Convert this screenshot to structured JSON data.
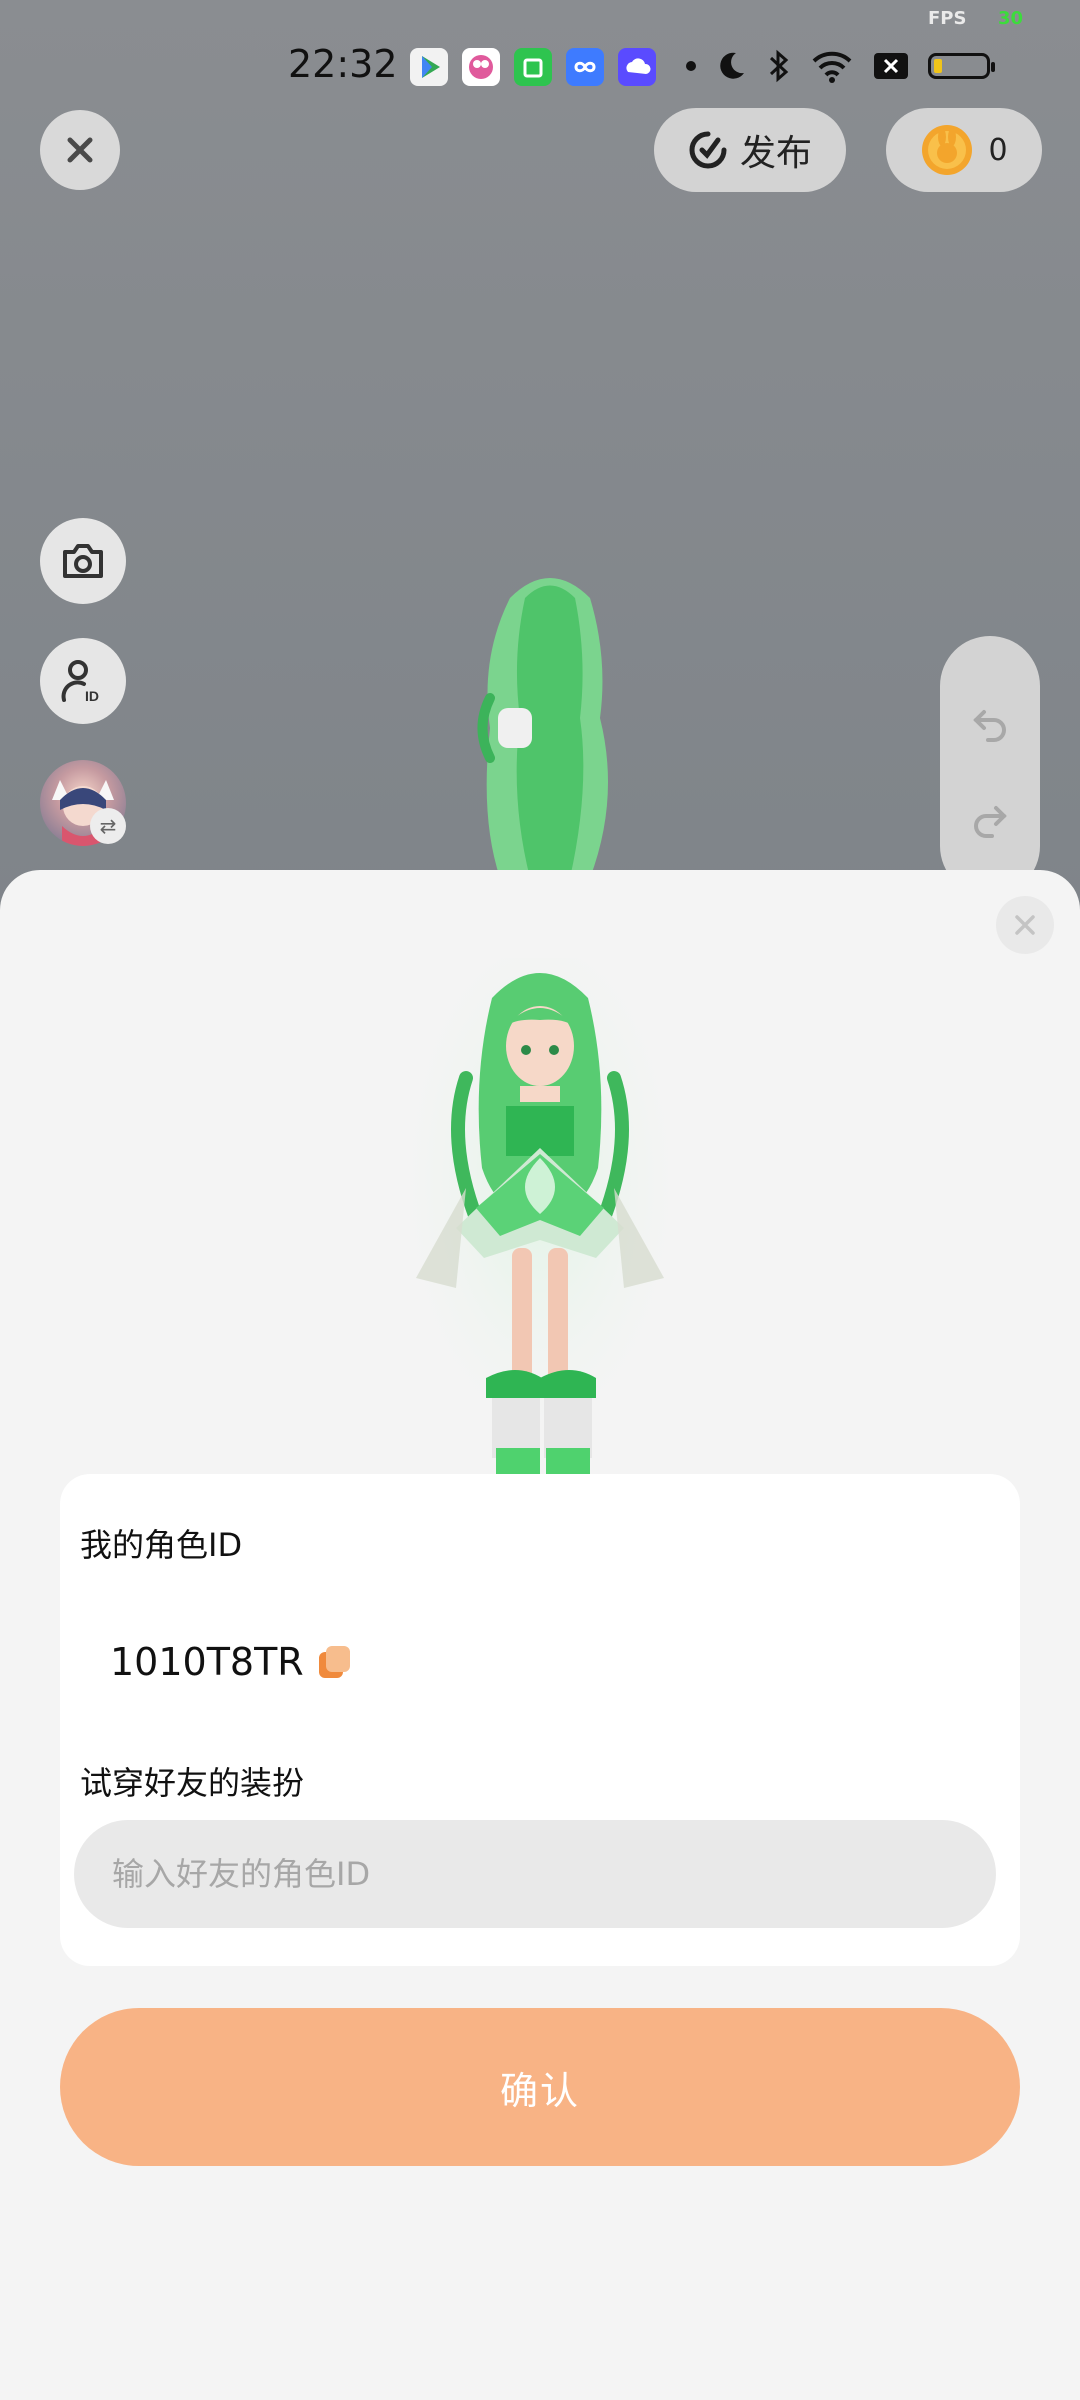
{
  "status_bar": {
    "fps_label": "FPS",
    "fps_value": "30",
    "time": "22:32"
  },
  "top_bar": {
    "publish_label": "发布",
    "coin_count": "0"
  },
  "sheet": {
    "my_id_label": "我的角色ID",
    "my_id_value": "1010T8TR",
    "tryon_label": "试穿好友的装扮",
    "friend_id_placeholder": "输入好友的角色ID",
    "confirm_label": "确认"
  },
  "colors": {
    "confirm_button": "#f8b385",
    "accent_orange": "#f08a3c"
  },
  "icons": {
    "close": "close-icon",
    "publish": "publish-icon",
    "coin": "coin-icon",
    "camera": "camera-icon",
    "user_id": "user-id-icon",
    "undo": "undo-icon",
    "redo": "redo-icon",
    "copy": "copy-icon"
  }
}
